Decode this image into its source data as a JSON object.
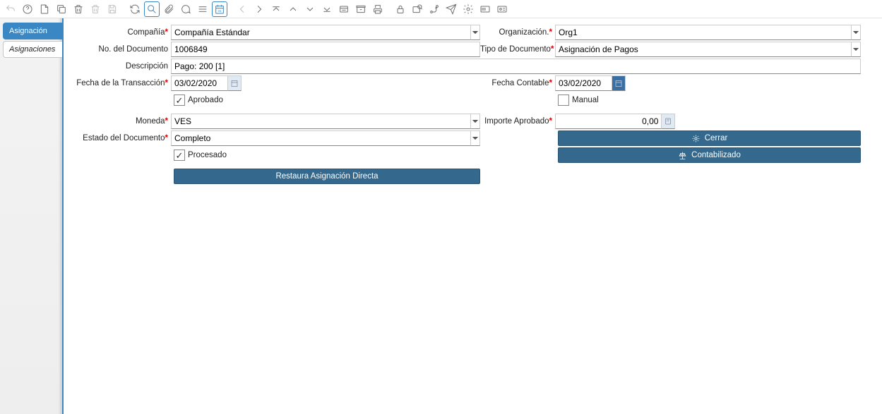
{
  "sidebar": {
    "tabs": [
      {
        "label": "Asignación",
        "active": true
      },
      {
        "label": "Asignaciones",
        "active": false
      }
    ]
  },
  "labels": {
    "company": "Compañía",
    "org": "Organización.",
    "docno": "No. del Documento",
    "doctype": "Tipo de Documento",
    "desc": "Descripción",
    "trxdate": "Fecha de la Transacción",
    "acctdate": "Fecha Contable",
    "approved": "Aprobado",
    "manual": "Manual",
    "currency": "Moneda",
    "approvedamt": "Importe Aprobado",
    "docstatus": "Estado del Documento",
    "processed": "Procesado"
  },
  "fields": {
    "company": "Compañía Estándar",
    "org": "Org1",
    "docno": "1006849",
    "doctype": "Asignación de Pagos",
    "desc": "Pago: 200 [1]",
    "trxdate": "03/02/2020",
    "acctdate": "03/02/2020",
    "approved": true,
    "manual": false,
    "currency": "VES",
    "approvedamt": "0,00",
    "docstatus": "Completo",
    "processed": true
  },
  "buttons": {
    "close": "Cerrar",
    "posted": "Contabilizado",
    "restore": "Restaura Asignación Directa"
  }
}
